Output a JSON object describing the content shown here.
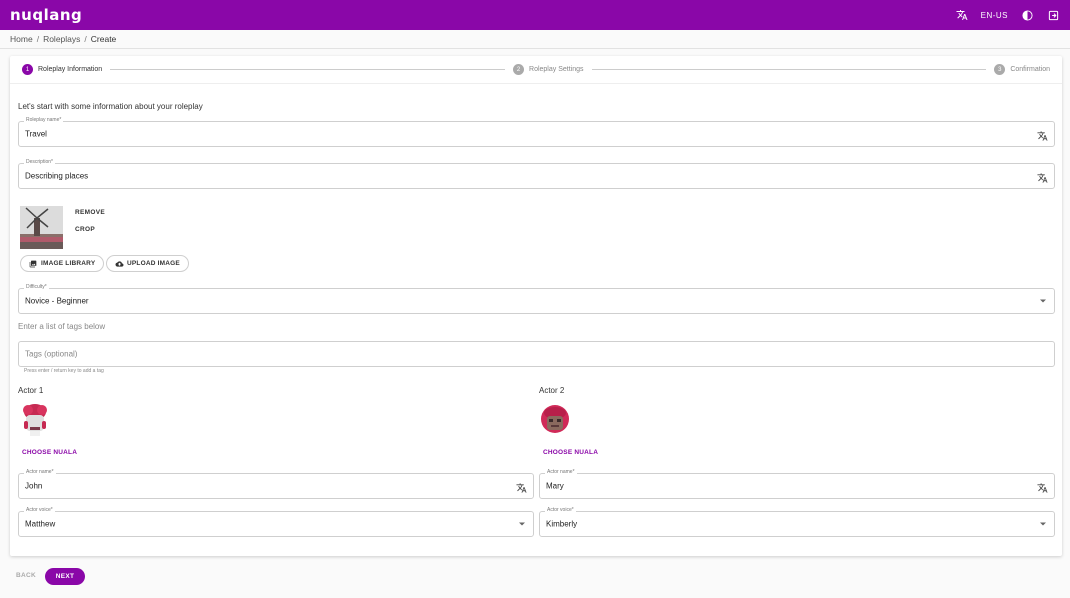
{
  "app": {
    "logo": "nuqlang",
    "brand_color": "#8a07a8"
  },
  "header": {
    "locale": "EN-US",
    "icons": [
      "translate-icon",
      "theme-toggle-icon",
      "logout-icon"
    ]
  },
  "breadcrumb": {
    "items": [
      "Home",
      "Roleplays",
      "Create"
    ],
    "separator": "/"
  },
  "stepper": {
    "steps": [
      {
        "num": "1",
        "label": "Roleplay Information"
      },
      {
        "num": "2",
        "label": "Roleplay Settings"
      },
      {
        "num": "3",
        "label": "Confirmation"
      }
    ]
  },
  "form": {
    "intro": "Let's start with some information about your roleplay",
    "name": {
      "label": "Roleplay name*",
      "value": "Travel"
    },
    "description": {
      "label": "Description*",
      "value": "Describing places"
    },
    "image": {
      "remove": "REMOVE",
      "crop": "CROP",
      "library": "IMAGE LIBRARY",
      "upload": "UPLOAD IMAGE"
    },
    "difficulty": {
      "label": "Difficulty*",
      "value": "Novice - Beginner"
    },
    "tags": {
      "hint": "Enter a list of tags below",
      "placeholder": "Tags (optional)",
      "helper": "Press enter / return key to add a tag"
    },
    "actor1": {
      "title": "Actor 1",
      "choose": "CHOOSE NUALA",
      "name_label": "Actor name*",
      "name": "John",
      "voice_label": "Actor voice*",
      "voice": "Matthew"
    },
    "actor2": {
      "title": "Actor 2",
      "choose": "CHOOSE NUALA",
      "name_label": "Actor name*",
      "name": "Mary",
      "voice_label": "Actor voice*",
      "voice": "Kimberly"
    }
  },
  "footer": {
    "back": "BACK",
    "next": "NEXT"
  }
}
